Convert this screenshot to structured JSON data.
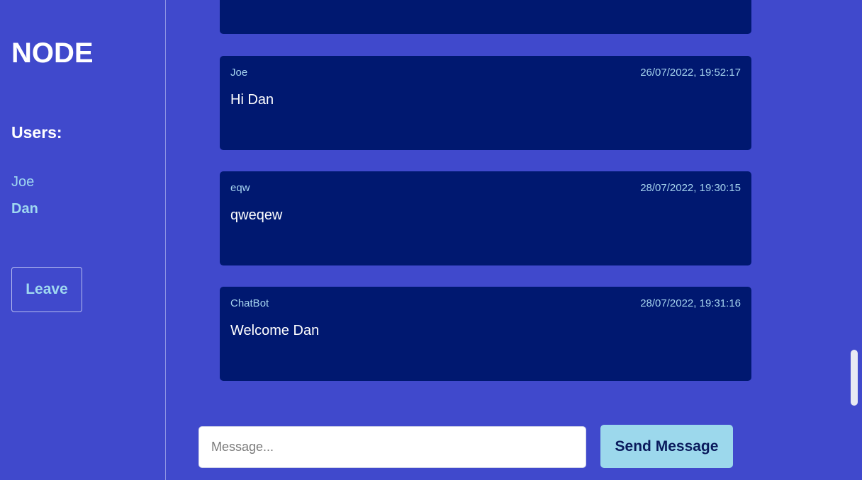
{
  "app": {
    "title": "NODE"
  },
  "sidebar": {
    "users_heading": "Users:",
    "users": [
      {
        "name": "Joe",
        "current": false
      },
      {
        "name": "Dan",
        "current": true
      }
    ],
    "leave_label": "Leave"
  },
  "messages": [
    {
      "user": "",
      "time": "",
      "text": ""
    },
    {
      "user": "Joe",
      "time": "26/07/2022, 19:52:17",
      "text": "Hi Dan"
    },
    {
      "user": "eqw",
      "time": "28/07/2022, 19:30:15",
      "text": "qweqew"
    },
    {
      "user": "ChatBot",
      "time": "28/07/2022, 19:31:16",
      "text": "Welcome Dan"
    }
  ],
  "composer": {
    "placeholder": "Message...",
    "value": "",
    "send_label": "Send Message"
  },
  "colors": {
    "background": "#4049cc",
    "message_card": "#001870",
    "accent_text": "#9fd8f0",
    "send_button": "#9cd8ec"
  }
}
